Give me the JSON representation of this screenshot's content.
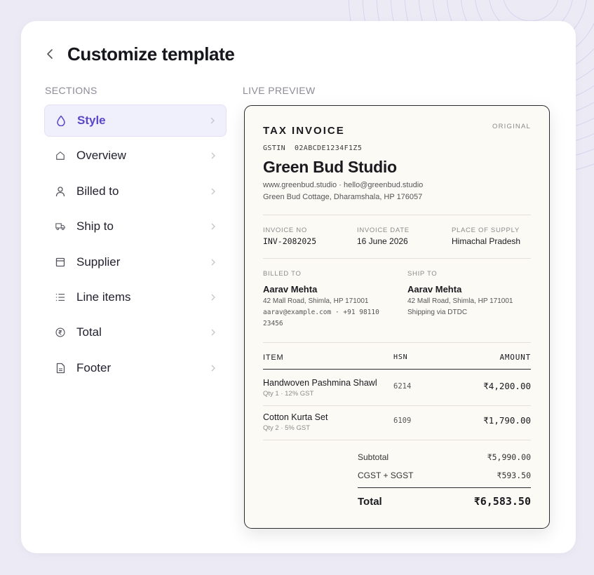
{
  "header": {
    "title": "Customize template"
  },
  "sections_label": "SECTIONS",
  "preview_label": "LIVE PREVIEW",
  "nav": [
    {
      "label": "Style",
      "icon": "droplet-icon",
      "active": true
    },
    {
      "label": "Overview",
      "icon": "home-icon"
    },
    {
      "label": "Billed to",
      "icon": "user-icon"
    },
    {
      "label": "Ship to",
      "icon": "truck-icon"
    },
    {
      "label": "Supplier",
      "icon": "building-icon"
    },
    {
      "label": "Line items",
      "icon": "list-icon"
    },
    {
      "label": "Total",
      "icon": "rupee-icon"
    },
    {
      "label": "Footer",
      "icon": "file-icon"
    }
  ],
  "colors": {
    "accent": "#5b47c7",
    "accent_bg": "#f0effc"
  },
  "invoice": {
    "title": "TAX INVOICE",
    "badge": "ORIGINAL",
    "gstin": "GSTIN  02ABCDE1234F1Z5",
    "company": "Green Bud Studio",
    "contact": "www.greenbud.studio · hello@greenbud.studio",
    "address": "Green Bud Cottage, Dharamshala, HP 176057",
    "meta": {
      "invoice_no_label": "INVOICE NO",
      "invoice_no": "INV-2082025",
      "invoice_date_label": "INVOICE DATE",
      "invoice_date": "16 June 2026",
      "supply_label": "PLACE OF SUPPLY",
      "supply": "Himachal Pradesh"
    },
    "billed_to": {
      "label": "BILLED TO",
      "name": "Aarav Mehta",
      "line1": "42 Mall Road, Shimla, HP 171001",
      "line2": "aarav@example.com · +91  98110",
      "line3": "23456"
    },
    "ship_to": {
      "label": "SHIP TO",
      "name": "Aarav Mehta",
      "line1": "42 Mall Road, Shimla, HP 171001",
      "line2": "Shipping via DTDC"
    },
    "table": {
      "item_header": "ITEM",
      "hsn_header": "HSN",
      "amount_header": "AMOUNT"
    },
    "items": [
      {
        "name": "Handwoven Pashmina Shawl",
        "sub": "Qty 1 · 12% GST",
        "hsn": "6214",
        "amount": "₹4,200.00"
      },
      {
        "name": "Cotton Kurta Set",
        "sub": "Qty 2 · 5% GST",
        "hsn": "6109",
        "amount": "₹1,790.00"
      }
    ],
    "summary": {
      "subtotal_label": "Subtotal",
      "subtotal": "₹5,990.00",
      "tax_label": "CGST + SGST",
      "tax": "₹593.50",
      "total_label": "Total",
      "total": "₹6,583.50"
    }
  }
}
